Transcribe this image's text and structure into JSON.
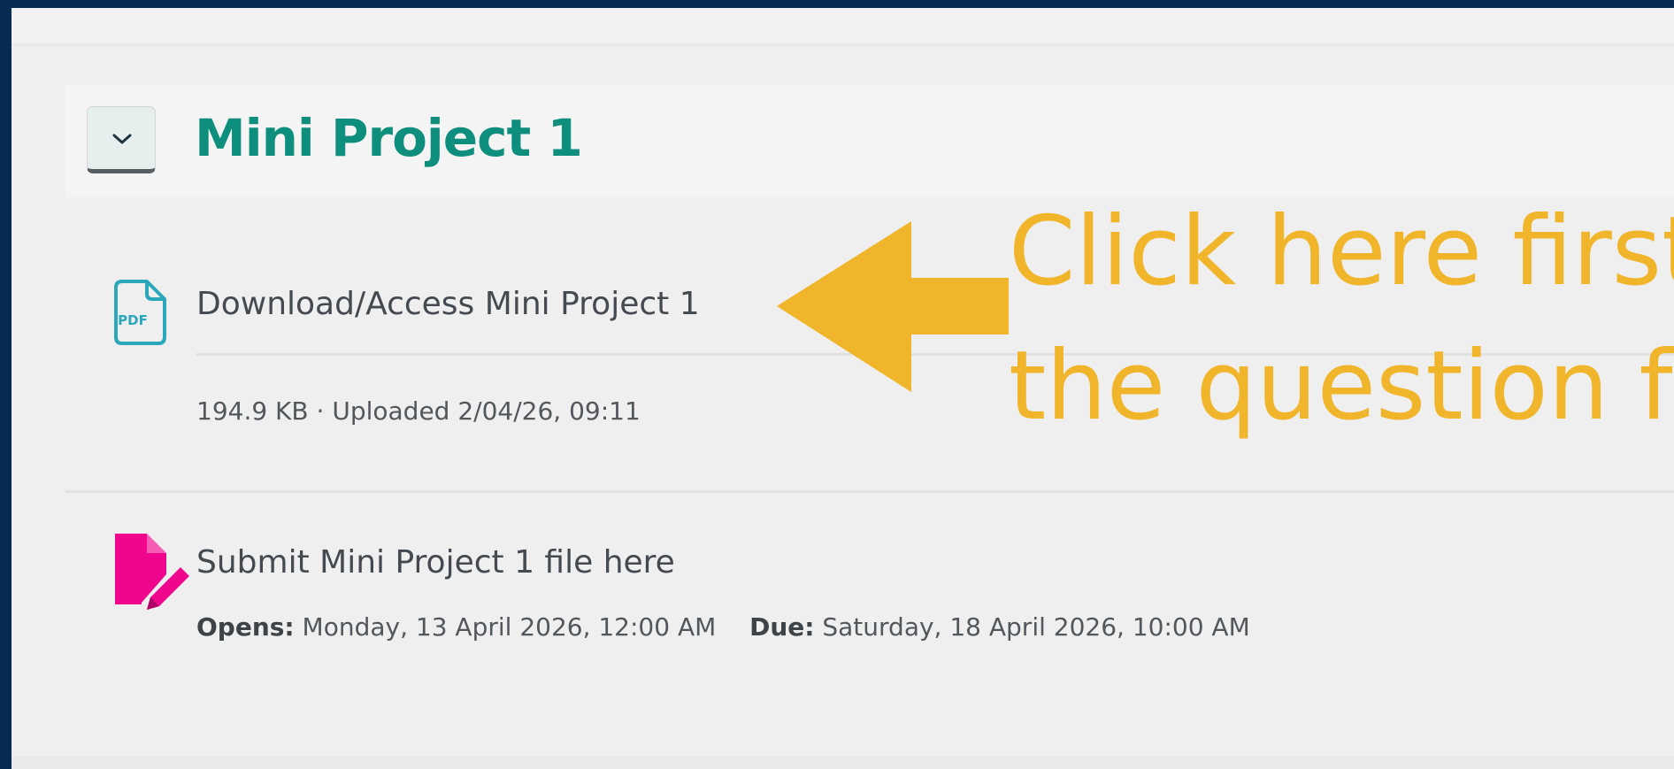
{
  "section": {
    "title": "Mini Project 1",
    "toggle_icon": "chevron-down-icon"
  },
  "activities": [
    {
      "icon": "pdf-file-icon",
      "name": "Download/Access Mini Project 1",
      "meta": "194.9 KB · Uploaded 2/04/26, 09:11"
    },
    {
      "icon": "assignment-submit-icon",
      "name": "Submit Mini Project 1 file here",
      "opens_label": "Opens:",
      "opens_value": "Monday, 13 April 2026, 12:00 AM",
      "due_label": "Due:",
      "due_value": "Saturday, 18 April 2026, 10:00 AM"
    }
  ],
  "annotation": {
    "line1": "Click here first",
    "line2": "the question f",
    "color": "#f0b52a"
  },
  "colors": {
    "frame": "#062a52",
    "page_bg": "#efefef",
    "title": "#0e8f7d",
    "pdf_icon": "#2aa7b9",
    "assign_icon": "#f0068c"
  }
}
